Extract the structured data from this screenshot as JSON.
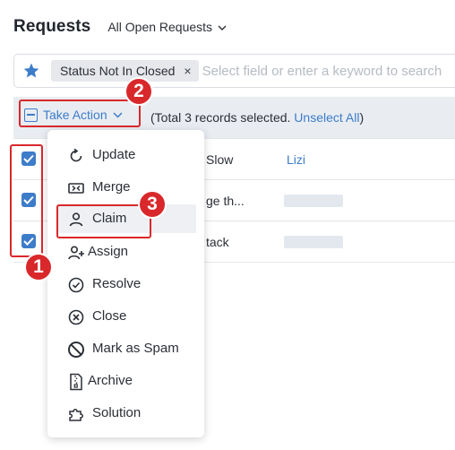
{
  "header": {
    "title": "Requests",
    "view_label": "All Open Requests"
  },
  "filter": {
    "chip_label": "Status Not In Closed",
    "chip_close": "×",
    "search_placeholder": "Select field or enter a keyword to search"
  },
  "action_bar": {
    "take_action_label": "Take Action",
    "selection_text": "(Total 3 records selected. ",
    "unselect_label": "Unselect All",
    "selection_end": ")"
  },
  "rows": [
    {
      "subject": "Slow",
      "technician": "Lizi"
    },
    {
      "subject": "ge th...",
      "technician": ""
    },
    {
      "subject": "tack",
      "technician": ""
    }
  ],
  "menu": {
    "items": [
      {
        "label": "Update",
        "icon": "refresh-icon"
      },
      {
        "label": "Merge",
        "icon": "merge-icon"
      },
      {
        "label": "Claim",
        "icon": "user-icon"
      },
      {
        "label": "Assign",
        "icon": "user-plus-icon"
      },
      {
        "label": "Resolve",
        "icon": "check-circle-icon"
      },
      {
        "label": "Close",
        "icon": "x-circle-icon"
      },
      {
        "label": "Mark as Spam",
        "icon": "ban-icon"
      },
      {
        "label": "Archive",
        "icon": "archive-file-icon"
      },
      {
        "label": "Solution",
        "icon": "puzzle-icon"
      }
    ]
  },
  "annotations": {
    "badge_1": "1",
    "badge_2": "2",
    "badge_3": "3"
  },
  "colors": {
    "accent": "#3d7cc9",
    "annotation": "#d9282b",
    "toolbar_bg": "#e9edf2"
  }
}
